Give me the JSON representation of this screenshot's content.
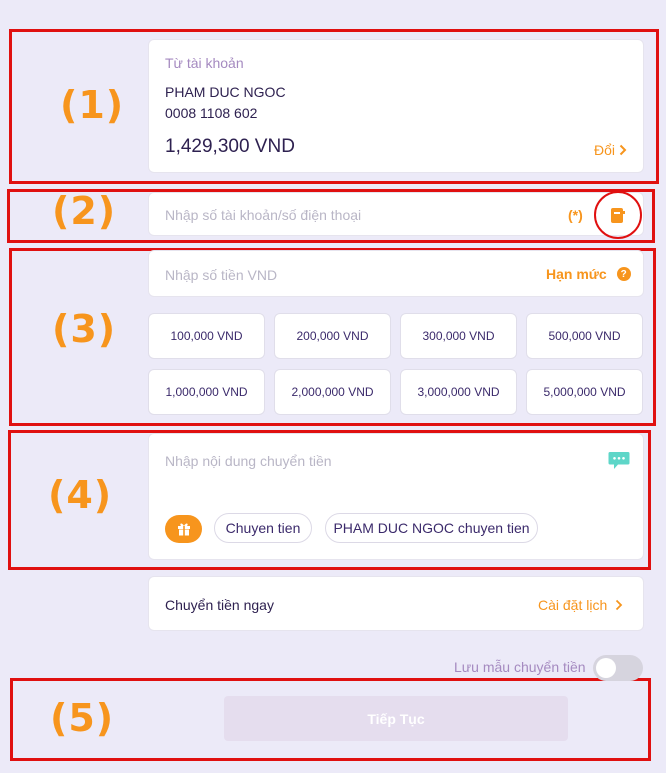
{
  "steps": [
    "(1)",
    "(2)",
    "(3)",
    "(4)",
    "(5)"
  ],
  "source_account": {
    "label": "Từ tài khoản",
    "name": "PHAM DUC NGOC",
    "number": "0008 1108 602",
    "balance": "1,429,300 VND",
    "change_label": "Đổi"
  },
  "recipient": {
    "placeholder": "Nhập số tài khoản/số điện thoại",
    "required_mark": "(*)",
    "icon": "contact-book-icon"
  },
  "amount": {
    "placeholder": "Nhập số tiền VND",
    "limit_label": "Hạn mức",
    "quick_amounts": [
      "100,000 VND",
      "200,000 VND",
      "300,000 VND",
      "500,000 VND",
      "1,000,000 VND",
      "2,000,000 VND",
      "3,000,000 VND",
      "5,000,000 VND"
    ]
  },
  "content": {
    "placeholder": "Nhập nội dung chuyển tiền",
    "suggestions": [
      "Chuyen tien",
      "PHAM DUC NGOC chuyen tien"
    ]
  },
  "schedule": {
    "label": "Chuyển tiền ngay",
    "action": "Cài đặt lịch"
  },
  "save_template": {
    "label": "Lưu mẫu chuyển tiền",
    "enabled": false
  },
  "submit_label": "Tiếp Tục",
  "colors": {
    "background": "#ECEAF8",
    "accent": "#F7951D",
    "text": "#3B2A6B",
    "annotation_border": "#E01010",
    "chat_icon": "#5ED6C8",
    "disabled_button": "#E5DDEE"
  }
}
